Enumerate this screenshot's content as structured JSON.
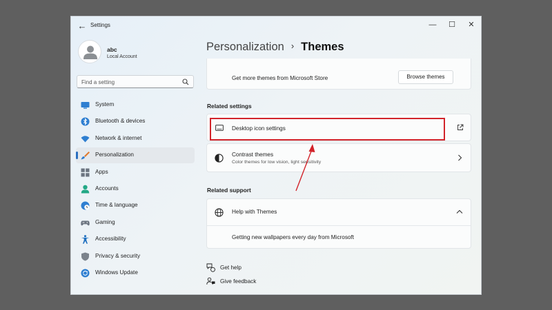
{
  "window": {
    "app_title": "Settings",
    "controls": {
      "minimize": "—",
      "maximize": "☐",
      "close": "✕"
    }
  },
  "profile": {
    "name": "abc",
    "account_type": "Local Account"
  },
  "search": {
    "placeholder": "Find a setting"
  },
  "nav": {
    "items": [
      {
        "label": "System",
        "icon": "system-icon",
        "active": false
      },
      {
        "label": "Bluetooth & devices",
        "icon": "bluetooth-icon",
        "active": false
      },
      {
        "label": "Network & internet",
        "icon": "wifi-icon",
        "active": false
      },
      {
        "label": "Personalization",
        "icon": "brush-icon",
        "active": true
      },
      {
        "label": "Apps",
        "icon": "apps-icon",
        "active": false
      },
      {
        "label": "Accounts",
        "icon": "accounts-icon",
        "active": false
      },
      {
        "label": "Time & language",
        "icon": "globe-clock-icon",
        "active": false
      },
      {
        "label": "Gaming",
        "icon": "gamepad-icon",
        "active": false
      },
      {
        "label": "Accessibility",
        "icon": "accessibility-icon",
        "active": false
      },
      {
        "label": "Privacy & security",
        "icon": "shield-icon",
        "active": false
      },
      {
        "label": "Windows Update",
        "icon": "update-icon",
        "active": false
      }
    ]
  },
  "breadcrumb": {
    "parent": "Personalization",
    "separator": "›",
    "current": "Themes"
  },
  "store": {
    "text": "Get more themes from Microsoft Store",
    "button_label": "Browse themes"
  },
  "related_settings": {
    "heading": "Related settings",
    "desktop_icon": {
      "label": "Desktop icon settings"
    },
    "contrast": {
      "title": "Contrast themes",
      "subtitle": "Color themes for low vision, light sensitivity"
    }
  },
  "related_support": {
    "heading": "Related support",
    "help": {
      "label": "Help with Themes",
      "link": "Getting new wallpapers every day from Microsoft"
    }
  },
  "footer": {
    "get_help": "Get help",
    "give_feedback": "Give feedback"
  },
  "annotation": {
    "highlight_color": "#d2232a"
  }
}
